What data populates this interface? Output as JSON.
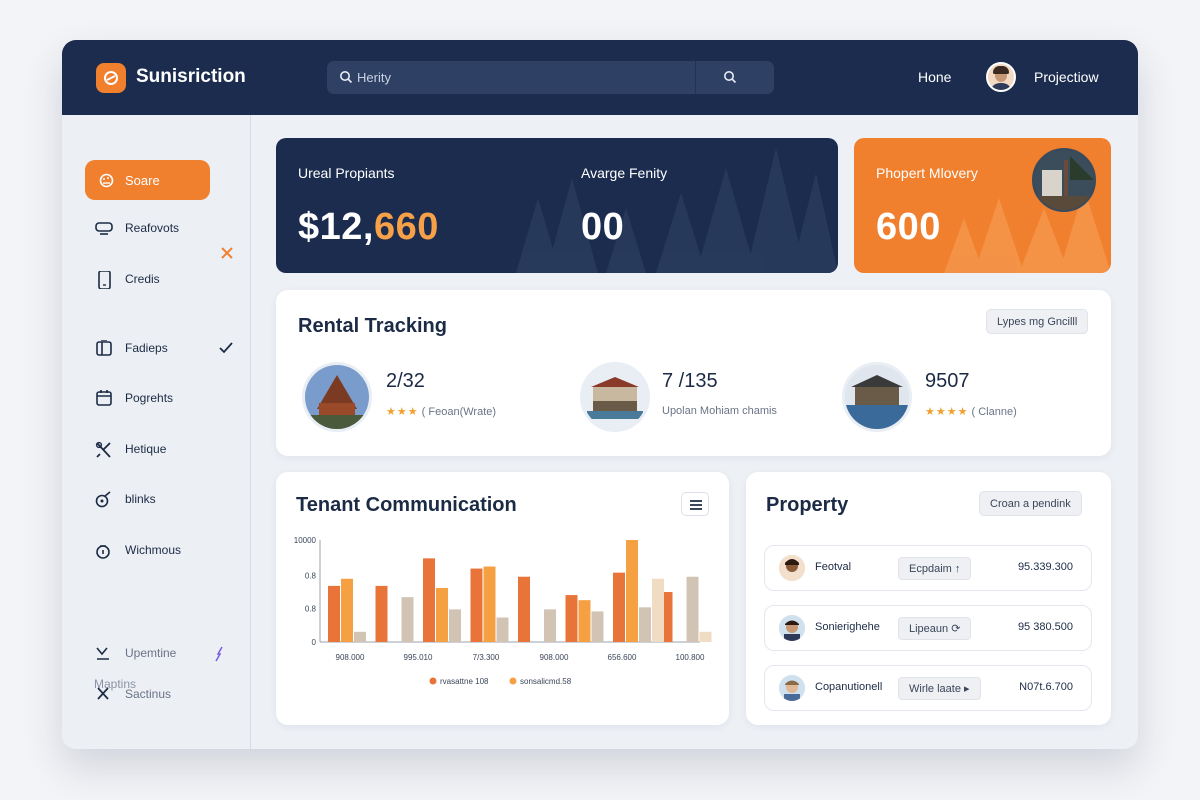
{
  "header": {
    "brand": "Sunisriction",
    "search_text": "Herity",
    "nav_home": "Hone",
    "nav_profile": "Projectiow"
  },
  "sidebar": {
    "items": [
      {
        "label": "Soare",
        "icon": "palette-icon",
        "active": true
      },
      {
        "label": "Reafovots",
        "icon": "inbox-icon"
      },
      {
        "label": "Credis",
        "icon": "phone-icon"
      },
      {
        "label": "Fadieps",
        "icon": "clipboard-icon"
      },
      {
        "label": "Pogrehts",
        "icon": "calendar-icon"
      },
      {
        "label": "Hetique",
        "icon": "tools-icon"
      },
      {
        "label": "blinks",
        "icon": "link-icon"
      },
      {
        "label": "Wichmous",
        "icon": "lock-icon"
      }
    ],
    "section_label": "Maptins",
    "sub_items": [
      {
        "label": "Upemtine",
        "icon": "download-icon"
      },
      {
        "label": "Sactinus",
        "icon": "close-icon"
      }
    ]
  },
  "kpis": [
    {
      "label": "Ureal Propiants",
      "value_prefix": "$12,",
      "value_accent": "660"
    },
    {
      "label": "Avarge Fenity",
      "value": "00"
    },
    {
      "label": "Phopert Mlovery",
      "value": "600"
    }
  ],
  "rental": {
    "title": "Rental Tracking",
    "button": "Lypes mg Gncilll",
    "stats": [
      {
        "value": "2/32",
        "stars": "★★★",
        "note": "( Feoan(Wrate)"
      },
      {
        "value": "7 /135",
        "stars": "",
        "note": "Upolan Mohiam chamis"
      },
      {
        "value": "9507",
        "stars": "★★★★",
        "note": "( Clanne)"
      }
    ]
  },
  "tenant": {
    "title": "Tenant Communication"
  },
  "chart_data": {
    "type": "bar",
    "title": "Tenant Communication",
    "y_ticks": [
      "10000",
      "0.8",
      "0.8",
      "0"
    ],
    "x_ticks": [
      "908.000",
      "995.010",
      "7/3.300",
      "908.000",
      "656.600",
      "100.800"
    ],
    "series": [
      {
        "name": "rvasattne 108",
        "color": "#e8743a",
        "values": [
          0.55,
          0.55,
          0.82,
          0.72,
          0.64,
          0.46,
          0.68,
          0.49
        ]
      },
      {
        "name": "sonsalicmd.58",
        "color": "#f5a043",
        "values": [
          0.62,
          0.0,
          0.53,
          0.74,
          0.0,
          0.41,
          1.0,
          0.0
        ]
      },
      {
        "name": "",
        "color": "#d2c4b4",
        "values": [
          0.1,
          0.44,
          0.32,
          0.24,
          0.32,
          0.3,
          0.34,
          0.64
        ]
      },
      {
        "name": "",
        "color": "#f0dcc2",
        "values": [
          0.0,
          0.0,
          0.0,
          0.0,
          0.0,
          0.0,
          0.62,
          0.1
        ]
      }
    ],
    "legend": [
      "rvasattne 108",
      "sonsalicmd.58"
    ]
  },
  "property": {
    "title": "Property",
    "button": "Croan a pendink",
    "rows": [
      {
        "name": "Feotval",
        "pill": "Ecpdaim",
        "pill_icon": "↑",
        "amount": "95.339.300"
      },
      {
        "name": "Sonierighehe",
        "pill": "Lipeaun",
        "pill_icon": "⟳",
        "amount": "95 380.500"
      },
      {
        "name": "Copanutionell",
        "pill": "Wirle laate",
        "pill_icon": "▸",
        "amount": "N07t.6.700"
      }
    ]
  },
  "colors": {
    "navy": "#1b2c4e",
    "accent_orange": "#f07f2e",
    "background": "#edf0f5"
  }
}
